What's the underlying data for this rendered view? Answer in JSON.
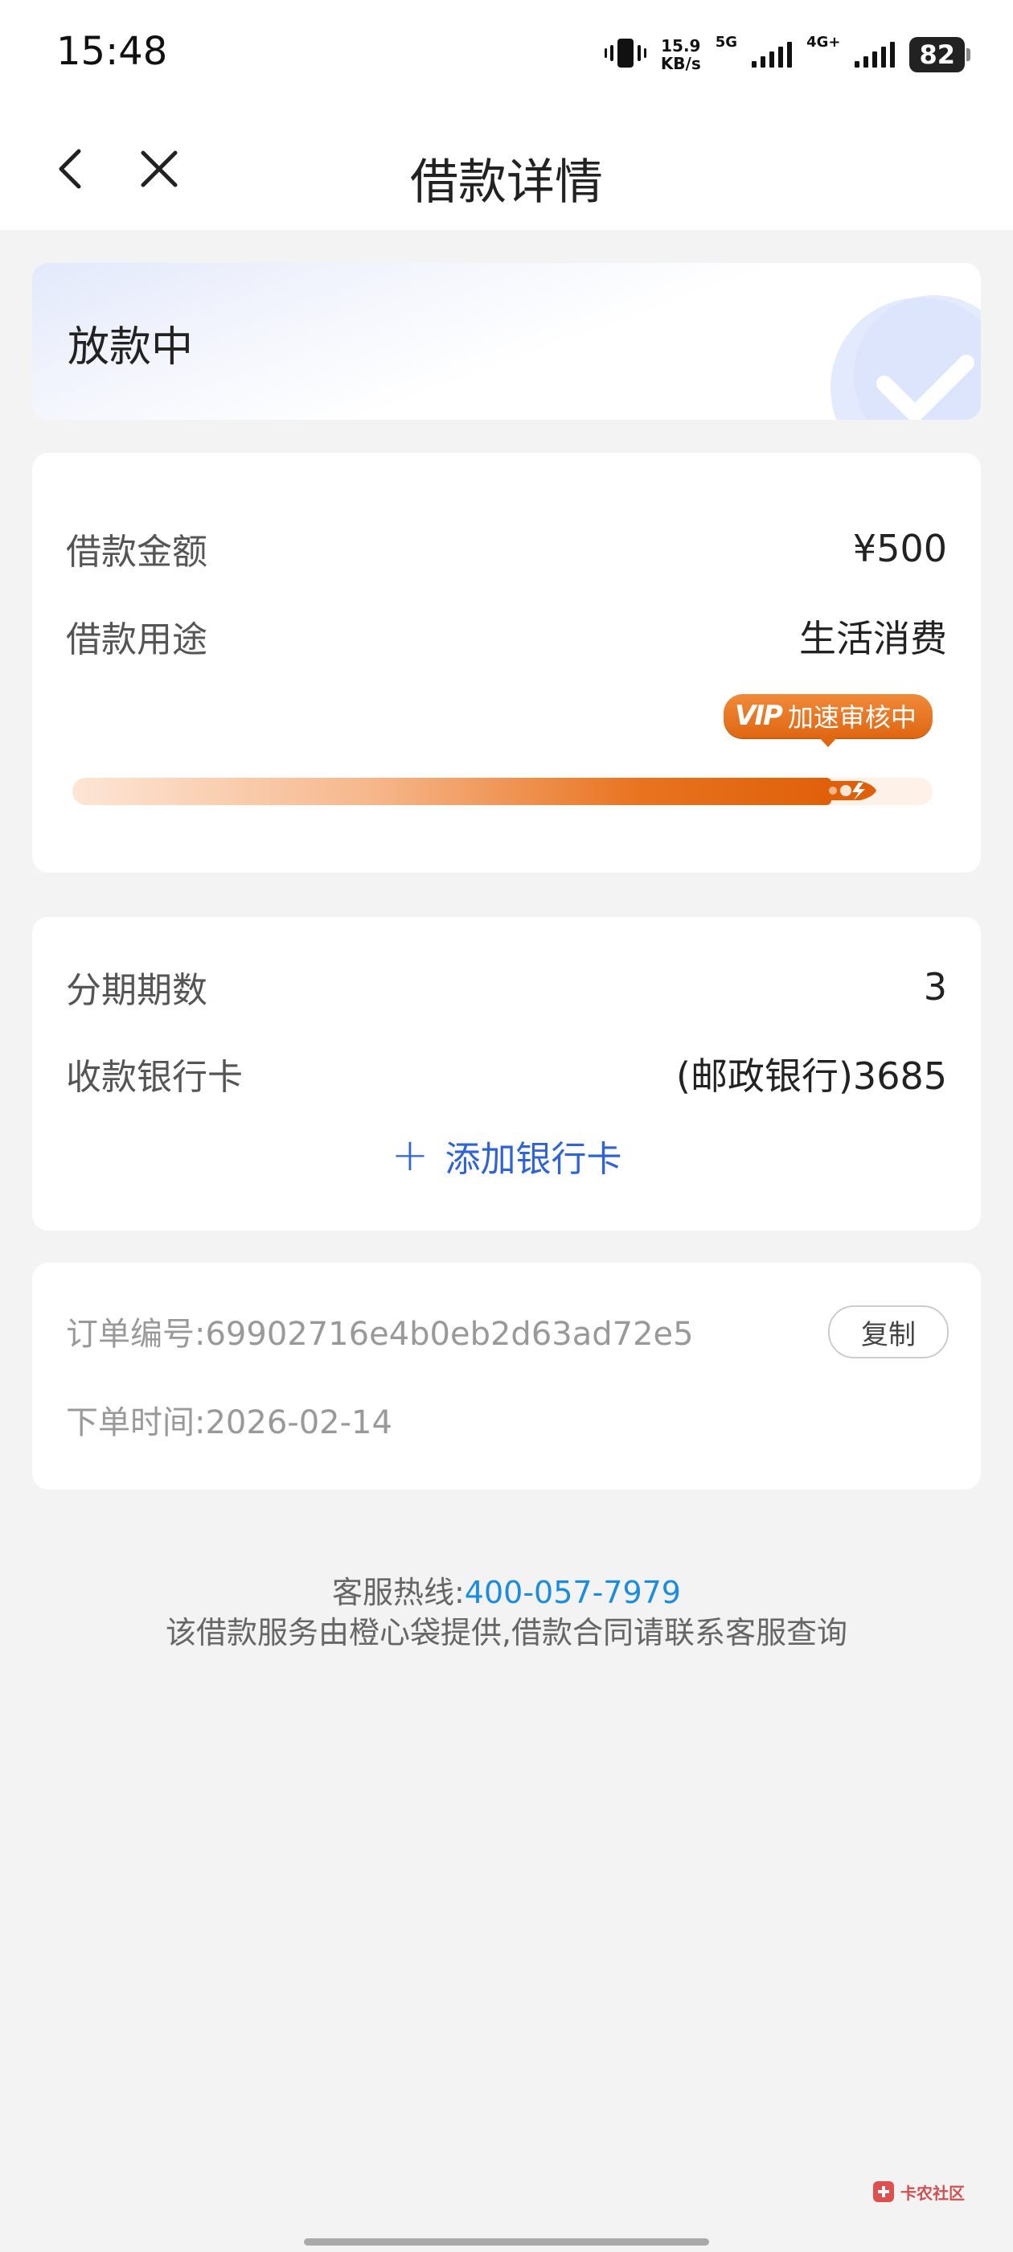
{
  "statusbar": {
    "time": "15:48",
    "net_speed_value": "15.9",
    "net_speed_unit": "KB/s",
    "sim1_label": "5G",
    "sim2_label": "4G+",
    "battery": "82"
  },
  "nav": {
    "title": "借款详情",
    "back_icon": "chevron-left-icon",
    "close_icon": "close-icon"
  },
  "status_card": {
    "status": "放款中",
    "icon": "check-icon"
  },
  "loan": {
    "amount_label": "借款金额",
    "amount_value": "¥500",
    "purpose_label": "借款用途",
    "purpose_value": "生活消费",
    "progress_tag_mark": "VIP",
    "progress_tag": "加速审核中",
    "progress_fraction": 0.92
  },
  "installment": {
    "periods_label": "分期期数",
    "periods_value": "3",
    "bank_label": "收款银行卡",
    "bank_value": "(邮政银行)3685",
    "add_card_label": "添加银行卡"
  },
  "order": {
    "number_label": "订单编号:",
    "number_value": "69902716e4b0eb2d63ad72e5",
    "copy_label": "复制",
    "time_label": "下单时间:",
    "time_value": "2026-02-14"
  },
  "footer": {
    "hotline_label": "客服热线:",
    "hotline_number": "400-057-7979",
    "note": "该借款服务由橙心袋提供,借款合同请联系客服查询"
  },
  "watermark": {
    "brand": "卡农社区"
  },
  "colors": {
    "accent_blue": "#2f63d6",
    "hotline_blue": "#1b8ce0",
    "progress_orange": "#e0600a",
    "background": "#f3f3f3"
  }
}
